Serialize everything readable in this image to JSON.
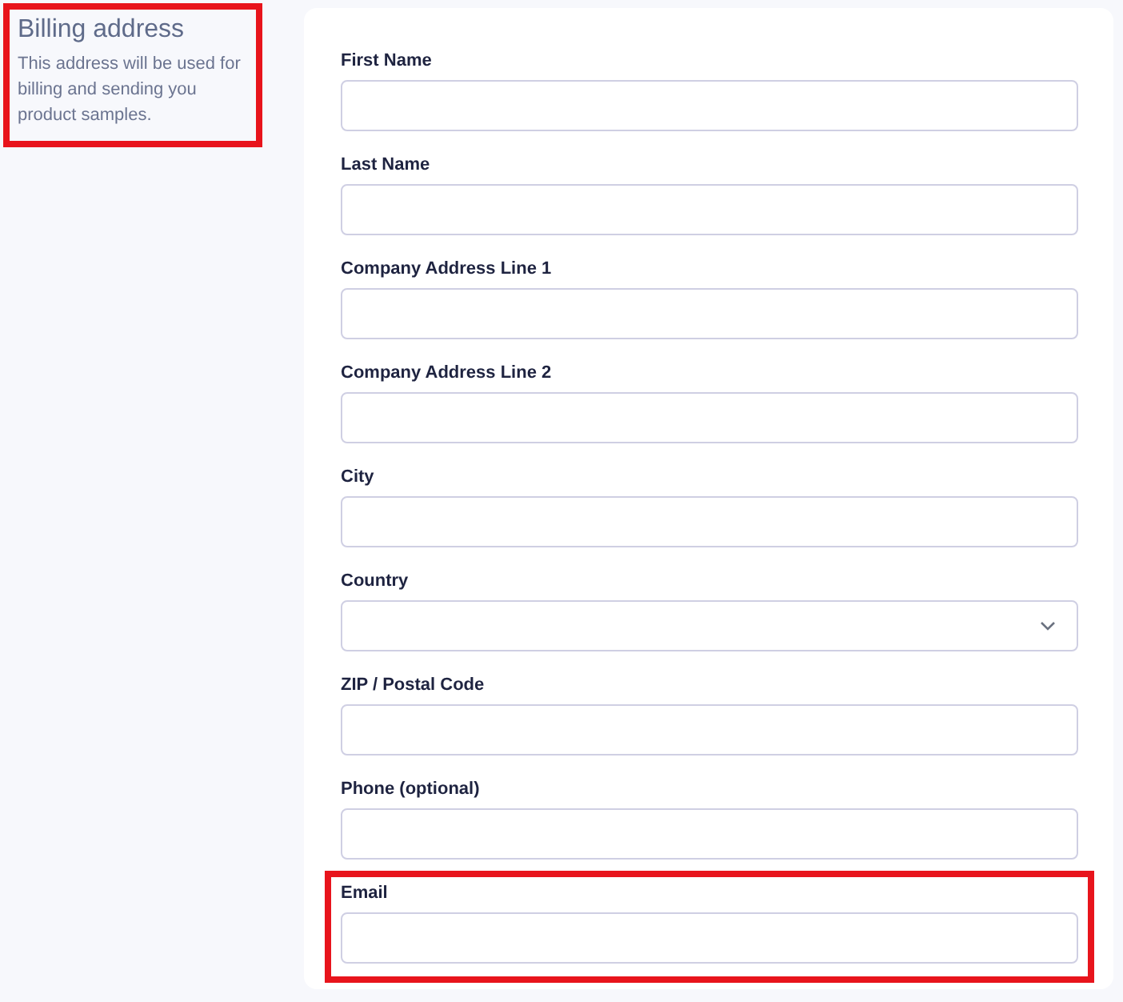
{
  "intro": {
    "title": "Billing address",
    "description": "This address will be used for billing and sending you product samples.",
    "highlighted": true
  },
  "fields": [
    {
      "label": "First Name",
      "kind": "text",
      "highlighted": false
    },
    {
      "label": "Last Name",
      "kind": "text",
      "highlighted": false
    },
    {
      "label": "Company Address Line 1",
      "kind": "text",
      "highlighted": false
    },
    {
      "label": "Company Address Line 2",
      "kind": "text",
      "highlighted": false
    },
    {
      "label": "City",
      "kind": "text",
      "highlighted": false
    },
    {
      "label": "Country",
      "kind": "select",
      "highlighted": false
    },
    {
      "label": "ZIP / Postal Code",
      "kind": "text",
      "highlighted": false
    },
    {
      "label": "Phone (optional)",
      "kind": "text",
      "highlighted": false
    },
    {
      "label": "Email",
      "kind": "text",
      "highlighted": true
    }
  ]
}
